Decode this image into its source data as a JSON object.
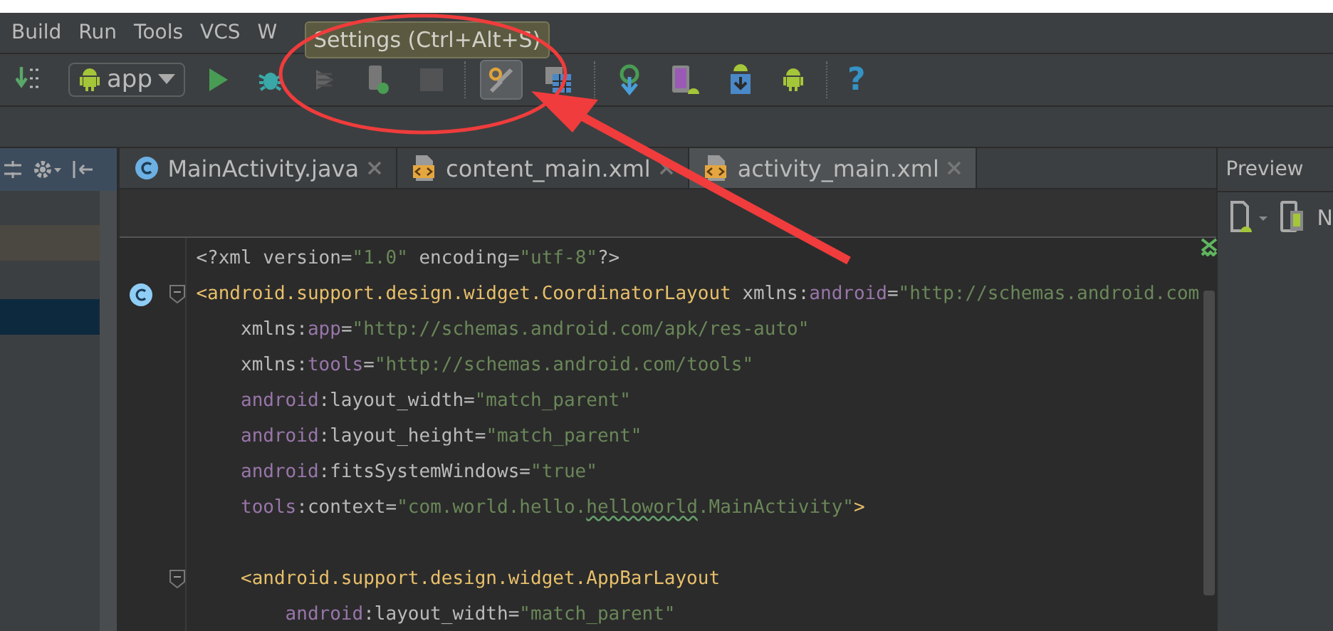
{
  "menu_bar": {
    "items": [
      {
        "label": "Build"
      },
      {
        "label": "Run"
      },
      {
        "label": "Tools"
      },
      {
        "label": "VCS"
      },
      {
        "label": "W"
      }
    ]
  },
  "toolbar": {
    "run_config": "app",
    "help": "?",
    "tooltip": "Settings (Ctrl+Alt+S)",
    "buttons": [
      {
        "kind": "make",
        "pressed": false,
        "disabled": false
      },
      {
        "kind": "run",
        "pressed": false,
        "disabled": false
      },
      {
        "kind": "debug",
        "pressed": false,
        "disabled": false
      },
      {
        "kind": "attach",
        "pressed": false,
        "disabled": true
      },
      {
        "kind": "device",
        "pressed": false,
        "disabled": false
      },
      {
        "kind": "stop",
        "pressed": false,
        "disabled": true
      },
      {
        "kind": "settings",
        "pressed": true,
        "disabled": false
      },
      {
        "kind": "structure",
        "pressed": false,
        "disabled": false
      },
      {
        "kind": "sync",
        "pressed": false,
        "disabled": false
      },
      {
        "kind": "avd",
        "pressed": false,
        "disabled": false
      },
      {
        "kind": "sdk",
        "pressed": false,
        "disabled": false
      },
      {
        "kind": "monitor",
        "pressed": false,
        "disabled": false
      }
    ]
  },
  "project_panel": {
    "rows": [
      {
        "selected": false,
        "highlighted": true
      },
      {
        "selected": true,
        "highlighted": false
      }
    ]
  },
  "tabs": [
    {
      "label": "MainActivity.java",
      "kind": "java",
      "selected": false
    },
    {
      "label": "content_main.xml",
      "kind": "xml",
      "selected": false
    },
    {
      "label": "activity_main.xml",
      "kind": "xml",
      "selected": true
    }
  ],
  "editor": {
    "lines": [
      {
        "class_marker": false,
        "fold": false,
        "segments": [
          {
            "kind": "text",
            "text": "<?xml version="
          },
          {
            "kind": "value",
            "text": "\"1.0\""
          },
          {
            "kind": "text",
            "text": " encoding="
          },
          {
            "kind": "value",
            "text": "\"utf-8\""
          },
          {
            "kind": "text",
            "text": "?>"
          }
        ]
      },
      {
        "class_marker": true,
        "fold": true,
        "segments": [
          {
            "kind": "tag",
            "text": "<android.support.design.widget.CoordinatorLayout"
          },
          {
            "kind": "text",
            "text": " xmlns:"
          },
          {
            "kind": "ns",
            "text": "android"
          },
          {
            "kind": "text",
            "text": "="
          },
          {
            "kind": "value",
            "text": "\"http://schemas.android.com"
          }
        ]
      },
      {
        "class_marker": false,
        "fold": false,
        "segments": [
          {
            "kind": "text",
            "text": "    xmlns:"
          },
          {
            "kind": "ns",
            "text": "app"
          },
          {
            "kind": "text",
            "text": "="
          },
          {
            "kind": "value",
            "text": "\"http://schemas.android.com/apk/res-auto\""
          }
        ]
      },
      {
        "class_marker": false,
        "fold": false,
        "segments": [
          {
            "kind": "text",
            "text": "    xmlns:"
          },
          {
            "kind": "ns",
            "text": "tools"
          },
          {
            "kind": "text",
            "text": "="
          },
          {
            "kind": "value",
            "text": "\"http://schemas.android.com/tools\""
          }
        ]
      },
      {
        "class_marker": false,
        "fold": false,
        "segments": [
          {
            "kind": "ns",
            "text": "    android"
          },
          {
            "kind": "text",
            "text": ":layout_width="
          },
          {
            "kind": "value",
            "text": "\"match_parent\""
          }
        ]
      },
      {
        "class_marker": false,
        "fold": false,
        "segments": [
          {
            "kind": "ns",
            "text": "    android"
          },
          {
            "kind": "text",
            "text": ":layout_height="
          },
          {
            "kind": "value",
            "text": "\"match_parent\""
          }
        ]
      },
      {
        "class_marker": false,
        "fold": false,
        "segments": [
          {
            "kind": "ns",
            "text": "    android"
          },
          {
            "kind": "text",
            "text": ":fitsSystemWindows="
          },
          {
            "kind": "value",
            "text": "\"true\""
          }
        ]
      },
      {
        "class_marker": false,
        "fold": false,
        "segments": [
          {
            "kind": "ns",
            "text": "    tools"
          },
          {
            "kind": "text",
            "text": ":context="
          },
          {
            "kind": "value",
            "text": "\"com.world.hello."
          },
          {
            "kind": "typo",
            "text": "helloworld"
          },
          {
            "kind": "value",
            "text": ".MainActivity\""
          },
          {
            "kind": "tag",
            "text": ">"
          }
        ]
      },
      {
        "class_marker": false,
        "fold": false
      },
      {
        "class_marker": false,
        "fold": true,
        "segments": [
          {
            "kind": "tag",
            "text": "    <android.support.design.widget.AppBarLayout"
          }
        ]
      },
      {
        "class_marker": false,
        "fold": false,
        "segments": [
          {
            "kind": "ns",
            "text": "        android"
          },
          {
            "kind": "text",
            "text": ":layout_width="
          },
          {
            "kind": "value",
            "text": "\"match_parent\""
          }
        ]
      }
    ]
  },
  "preview": {
    "title": "Preview",
    "toolbar_label": "N"
  }
}
